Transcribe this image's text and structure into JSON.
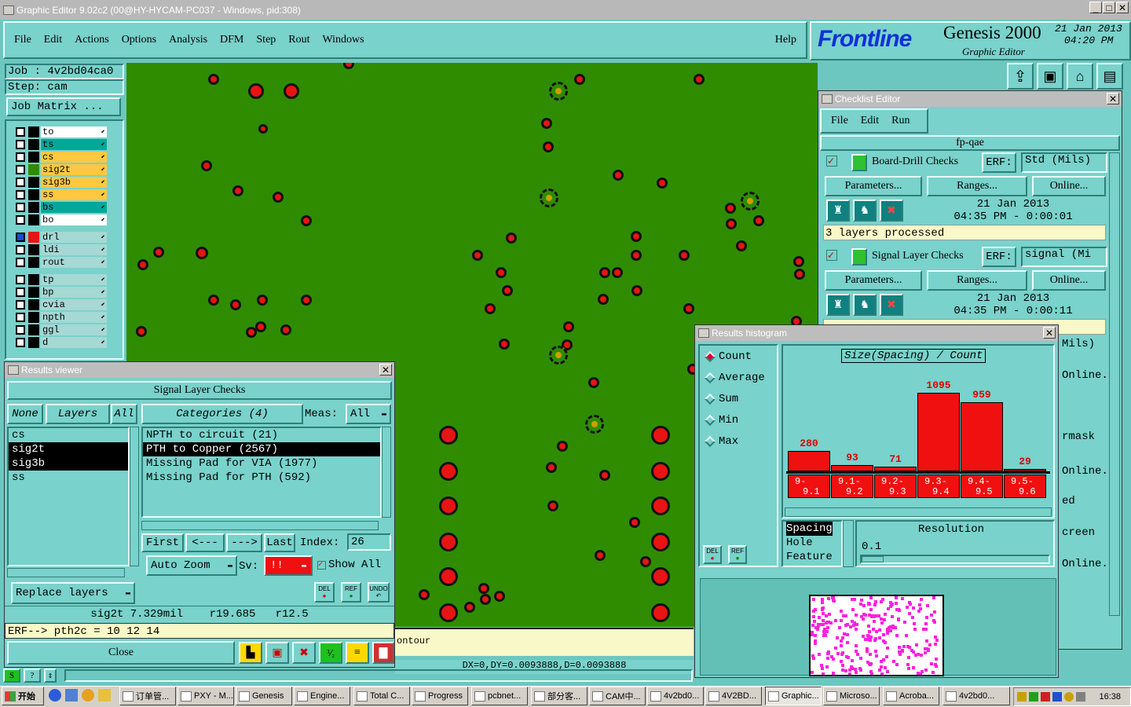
{
  "window": {
    "title": "Graphic Editor 9.02c2 (00@HY-HYCAM-PC037 - Windows, pid:308)"
  },
  "menu": [
    "File",
    "Edit",
    "Actions",
    "Options",
    "Analysis",
    "DFM",
    "Step",
    "Rout",
    "Windows"
  ],
  "help": "Help",
  "brand": {
    "logo": "Frontline",
    "product": "Genesis 2000",
    "subtitle": "Graphic Editor",
    "date": "21 Jan 2013",
    "time": "04:20 PM"
  },
  "job": {
    "job": "Job : 4v2bd04ca0",
    "step": "Step: cam",
    "matrix_btn": "Job Matrix ..."
  },
  "layers": [
    {
      "name": "to",
      "color": "#ffffff"
    },
    {
      "name": "ts",
      "color": "#00a89a"
    },
    {
      "name": "cs",
      "color": "#ffc840"
    },
    {
      "name": "sig2t",
      "color": "#ffc840"
    },
    {
      "name": "sig3b",
      "color": "#ffc840"
    },
    {
      "name": "ss",
      "color": "#ffc840"
    },
    {
      "name": "bs",
      "color": "#00a89a"
    },
    {
      "name": "bo",
      "color": "#ffffff"
    }
  ],
  "layers2": [
    {
      "name": "drl"
    },
    {
      "name": "ldi"
    },
    {
      "name": "rout"
    }
  ],
  "layers3": [
    {
      "name": "tp"
    },
    {
      "name": "bp"
    },
    {
      "name": "cvia"
    },
    {
      "name": "npth"
    },
    {
      "name": "ggl"
    },
    {
      "name": "d"
    }
  ],
  "results_viewer": {
    "title": "Results viewer",
    "heading": "Signal Layer Checks",
    "none": "None",
    "layers": "Layers",
    "all": "All",
    "categories": "Categories (4)",
    "meas_label": "Meas:",
    "meas_value": "All",
    "layer_list": [
      "cs",
      "sig2t",
      "sig3b",
      "ss"
    ],
    "cat_list": [
      "NPTH to circuit (21)",
      "PTH to Copper (2567)",
      "Missing Pad for VIA (1977)",
      "Missing Pad for PTH (592)"
    ],
    "first": "First",
    "prev": "<---",
    "next": "--->",
    "last": "Last",
    "index_label": "Index:",
    "index_value": "26",
    "auto_zoom": "Auto Zoom",
    "sv_label": "Sv:",
    "sv_value": "!!",
    "show_all": "Show All",
    "replace_layers": "Replace layers",
    "del": "DEL",
    "ref": "REF",
    "undo": "UNDO",
    "info1": "sig2t 7.329mil    r19.685   r12.5",
    "info2": "ERF--> pth2c = 10 12 14",
    "close": "Close"
  },
  "checklist": {
    "title": "Checklist Editor",
    "menu": [
      "File",
      "Edit",
      "Run"
    ],
    "name": "fp-qae",
    "items": [
      {
        "label": "Board-Drill Checks",
        "erf": "ERF:",
        "erf_value": "Std (Mils)",
        "params": "Parameters...",
        "ranges": "Ranges...",
        "online": "Online...",
        "date": "21 Jan 2013",
        "time": "04:35 PM - 0:00:01",
        "status": "3 layers processed"
      },
      {
        "label": "Signal Layer Checks",
        "erf": "ERF:",
        "erf_value": "signal (Mi",
        "params": "Parameters...",
        "ranges": "Ranges...",
        "online": "Online...",
        "date": "21 Jan 2013",
        "time": "04:35 PM - 0:00:11",
        "status": ""
      }
    ],
    "right_frag": [
      "Mils)",
      "Online...",
      "rmask",
      "Online...",
      "ed",
      "creen",
      "Online..."
    ]
  },
  "histogram": {
    "title": "Results histogram",
    "modes": [
      "Count",
      "Average",
      "Sum",
      "Min",
      "Max"
    ],
    "chart_title": "Size(Spacing) / Count",
    "del": "DEL",
    "ref": "REF",
    "by": [
      "Spacing",
      "Hole",
      "Feature"
    ],
    "resolution_label": "Resolution",
    "resolution_value": "0.1"
  },
  "chart_data": {
    "type": "bar",
    "title": "Size(Spacing) / Count",
    "categories": [
      "9-9.1",
      "9.1-9.2",
      "9.2-9.3",
      "9.3-9.4",
      "9.4-9.5",
      "9.5-9.6"
    ],
    "category_lines": [
      [
        "9-",
        "9.1"
      ],
      [
        "9.1-",
        "9.2"
      ],
      [
        "9.2-",
        "9.3"
      ],
      [
        "9.3-",
        "9.4"
      ],
      [
        "9.4-",
        "9.5"
      ],
      [
        "9.5-",
        "9.6"
      ]
    ],
    "values": [
      280,
      93,
      71,
      1095,
      959,
      29
    ],
    "ylim": [
      0,
      1095
    ],
    "bar_color": "#f01010",
    "label_color": "#e00000"
  },
  "status": {
    "contour": "ontour",
    "coords": "DX=0,DY=0.0093888,D=0.0093888"
  },
  "taskbar": {
    "start": "开始",
    "items": [
      "订单管...",
      "PXY - M...",
      "Genesis",
      "Engine...",
      "Total C...",
      "Progress",
      "pcbnet...",
      "部分客...",
      "CAM中...",
      "4v2bd0...",
      "4V2BD...",
      "Graphic...",
      "Microso...",
      "Acroba...",
      "4v2bd0..."
    ],
    "clock": "16:38"
  }
}
